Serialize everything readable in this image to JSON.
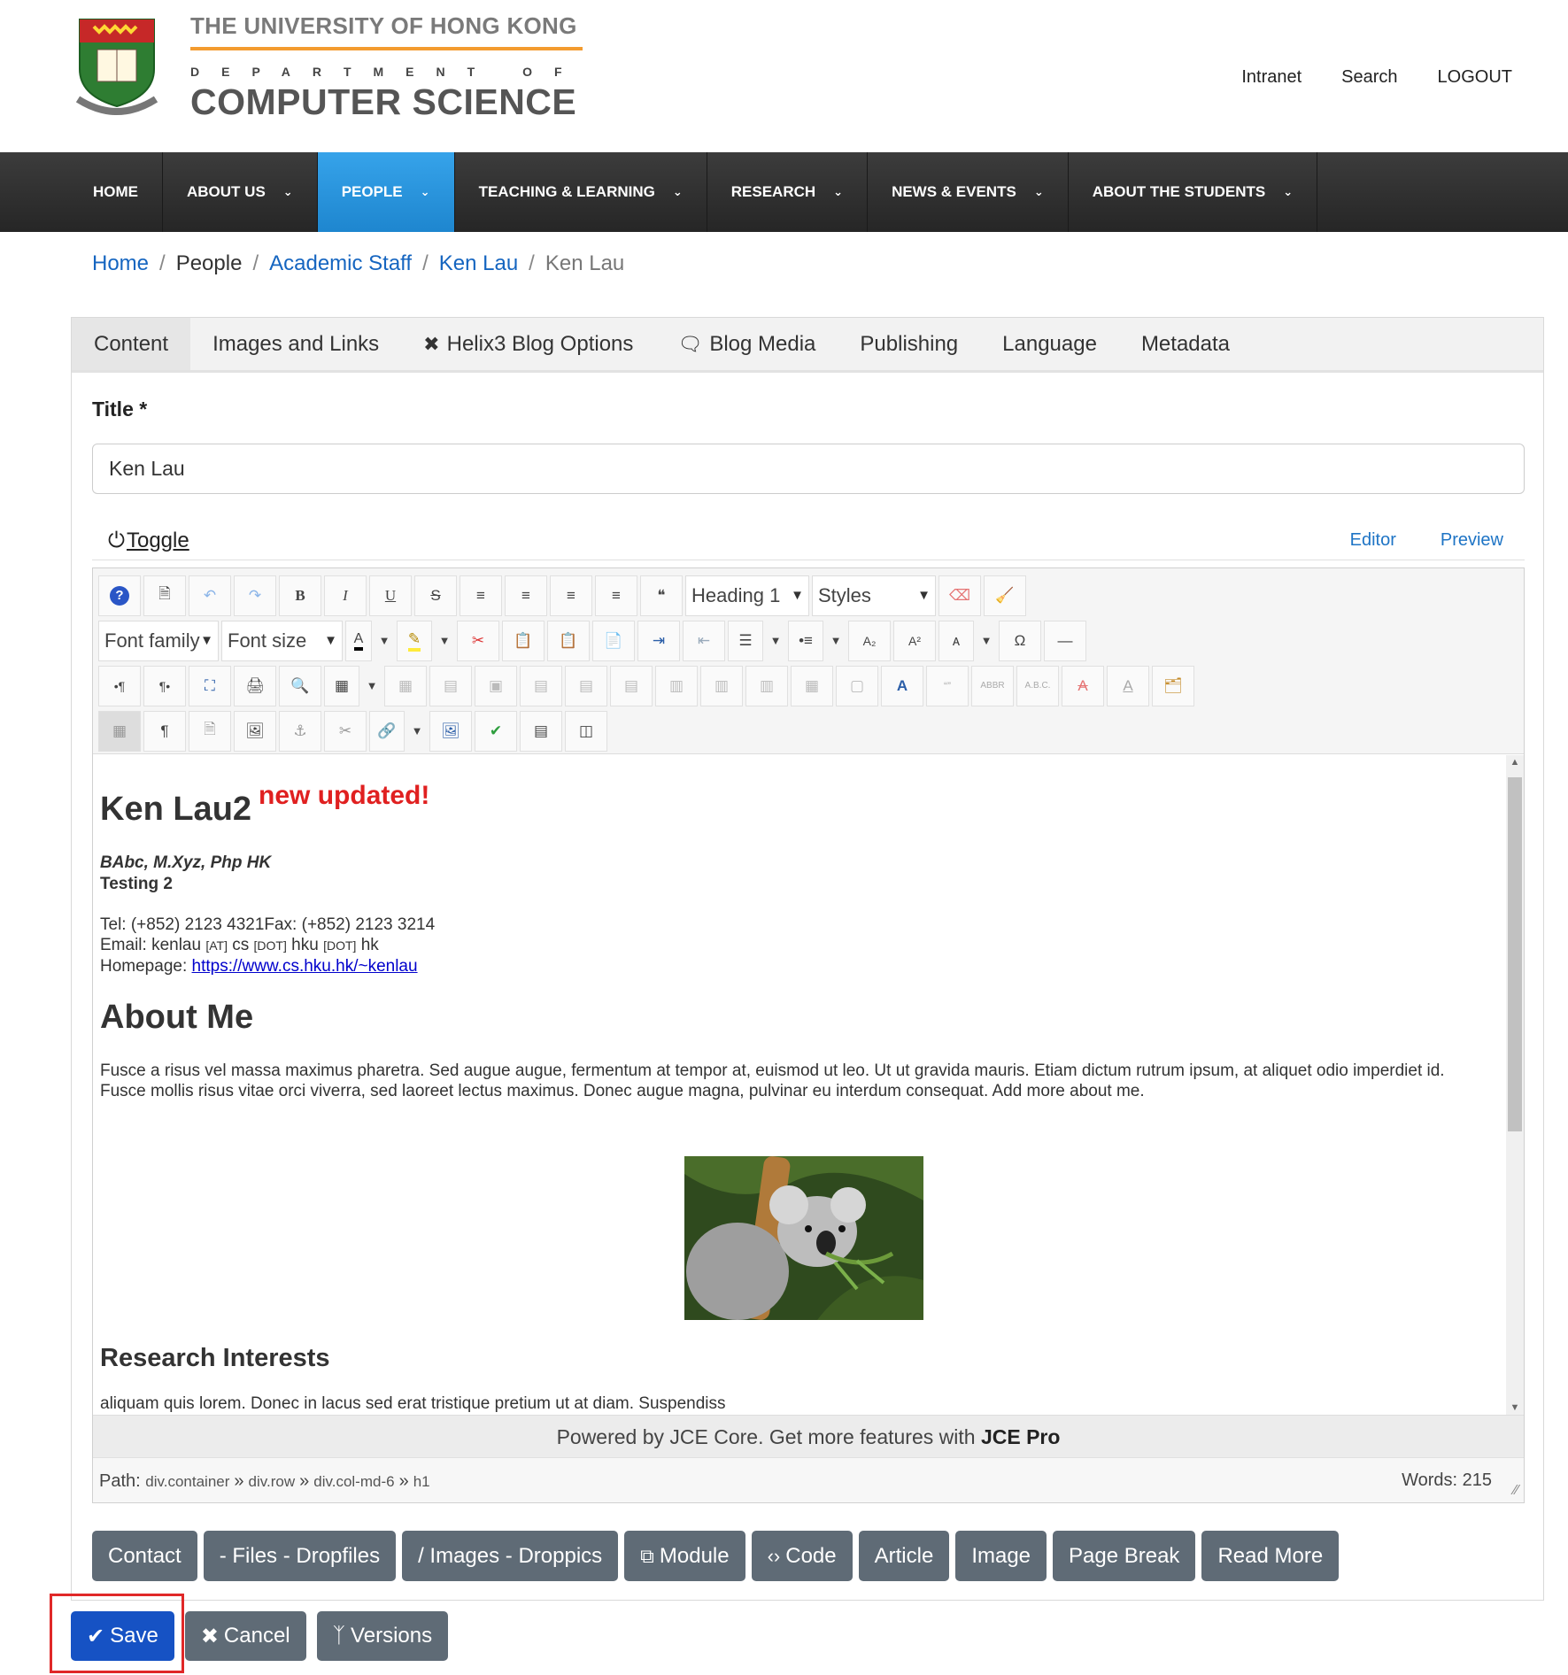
{
  "header": {
    "university": "THE UNIVERSITY OF HONG KONG",
    "department": "DEPARTMENT OF",
    "department_name": "COMPUTER SCIENCE",
    "top_links": [
      "Intranet",
      "Search",
      "LOGOUT"
    ]
  },
  "nav": {
    "items": [
      {
        "label": "HOME"
      },
      {
        "label": "ABOUT US"
      },
      {
        "label": "PEOPLE"
      },
      {
        "label": "TEACHING & LEARNING"
      },
      {
        "label": "RESEARCH"
      },
      {
        "label": "NEWS & EVENTS"
      },
      {
        "label": "ABOUT THE STUDENTS"
      }
    ],
    "active": "PEOPLE"
  },
  "breadcrumb": {
    "home": "Home",
    "people": "People",
    "academic_staff": "Academic Staff",
    "ken_lau_link": "Ken Lau",
    "current": "Ken Lau",
    "separator": "/"
  },
  "tabs": {
    "content": "Content",
    "images_links": "Images and Links",
    "helix3": "Helix3 Blog Options",
    "blog_media": "Blog Media",
    "publishing": "Publishing",
    "language": "Language",
    "metadata": "Metadata"
  },
  "form": {
    "title_label": "Title *",
    "title_value": "Ken Lau"
  },
  "editor": {
    "toggle": "Toggle",
    "editor_link": "Editor",
    "preview_link": "Preview",
    "format_select": "Heading 1",
    "styles_select": "Styles",
    "font_family": "Font family",
    "font_size": "Font size",
    "powered_prefix": "Powered by JCE Core. Get more features with ",
    "powered_brand": "JCE Pro",
    "path_label": "Path:",
    "path": [
      "div.container",
      "div.row",
      "div.col-md-6",
      "h1"
    ],
    "path_sep": "»",
    "words": "Words: 215"
  },
  "document": {
    "heading": "Ken Lau2",
    "updated_note": "new updated!",
    "degrees": "BAbc, M.Xyz, Php HK",
    "testing": "Testing 2",
    "tel_fax": "Tel: (+852) 2123  4321Fax: (+852) 2123 3214",
    "email_prefix": "Email: kenlau ",
    "email_at": "[AT]",
    "email_cs": " cs ",
    "email_dot1": "[DOT]",
    "email_hku": " hku ",
    "email_dot2": "[DOT]",
    "email_hk": " hk",
    "homepage_label": "Homepage: ",
    "homepage_url": "https://www.cs.hku.hk/~kenlau",
    "about_heading": "About Me",
    "about_text": "Fusce a risus vel massa maximus pharetra. Sed augue augue, fermentum at tempor at, euismod ut leo. Ut ut gravida mauris. Etiam dictum rutrum ipsum, at aliquet odio imperdiet id. Fusce mollis risus vitae orci viverra, sed laoreet lectus maximus. Donec augue magna, pulvinar eu interdum consequat. Add more about me.",
    "research_heading": "Research Interests",
    "research_text": "aliquam quis lorem. Donec in lacus sed erat tristique pretium ut at diam. Suspendiss"
  },
  "extra_buttons": {
    "contact": "Contact",
    "files": "- Files - Dropfiles",
    "images": "/ Images - Droppics",
    "module": "Module",
    "code": "Code",
    "article": "Article",
    "image": "Image",
    "page_break": "Page Break",
    "read_more": "Read More"
  },
  "actions": {
    "save": "Save",
    "cancel": "Cancel",
    "versions": "Versions"
  },
  "colors": {
    "nav_active": "#1e86cf",
    "primary_button": "#1652c4",
    "secondary_button": "#5f6b76",
    "updated_note": "#e02020",
    "highlight_box": "#e02828"
  }
}
